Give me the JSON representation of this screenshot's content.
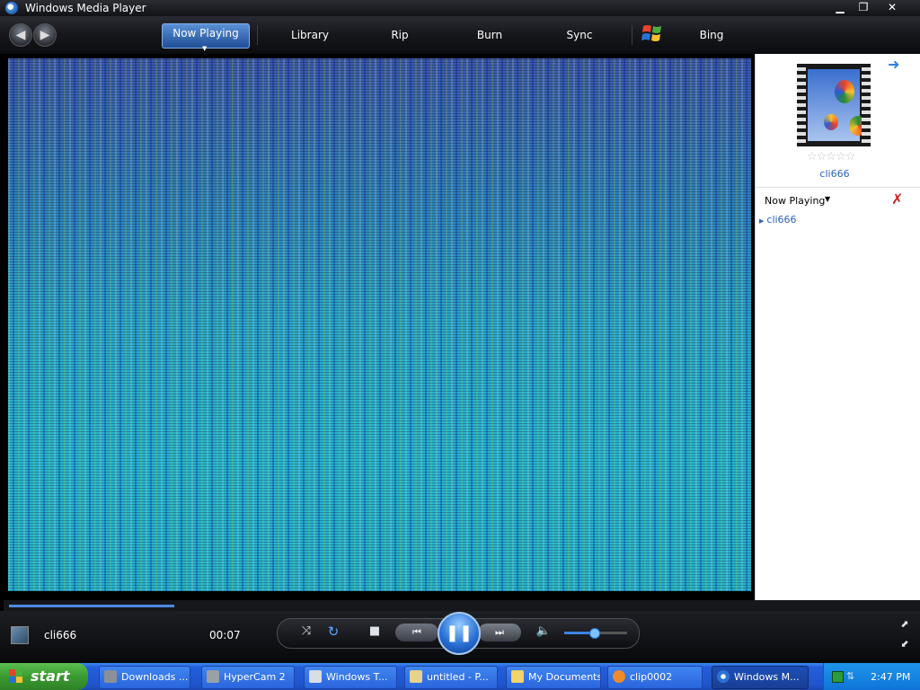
{
  "window": {
    "title": "Windows Media Player"
  },
  "nav": {
    "tabs": [
      "Now Playing",
      "Library",
      "Rip",
      "Burn",
      "Sync",
      "Bing"
    ]
  },
  "right_pane": {
    "album_title": "cli666",
    "list_label": "Now Playing",
    "playlist": [
      "cli666"
    ]
  },
  "player": {
    "track_title": "cli666",
    "time": "00:07",
    "volume_level": 0.45,
    "seek_progress": 0.18
  },
  "taskbar": {
    "start_label": "start",
    "items": [
      "Downloads ...",
      "HyperCam 2",
      "Windows T...",
      "untitled - P...",
      "My Documents",
      "clip0002",
      "Windows M..."
    ],
    "clock": "2:47 PM"
  },
  "colors": {
    "accent": "#2a72d6",
    "taskbar": "#245edb",
    "start": "#3a9a30"
  }
}
